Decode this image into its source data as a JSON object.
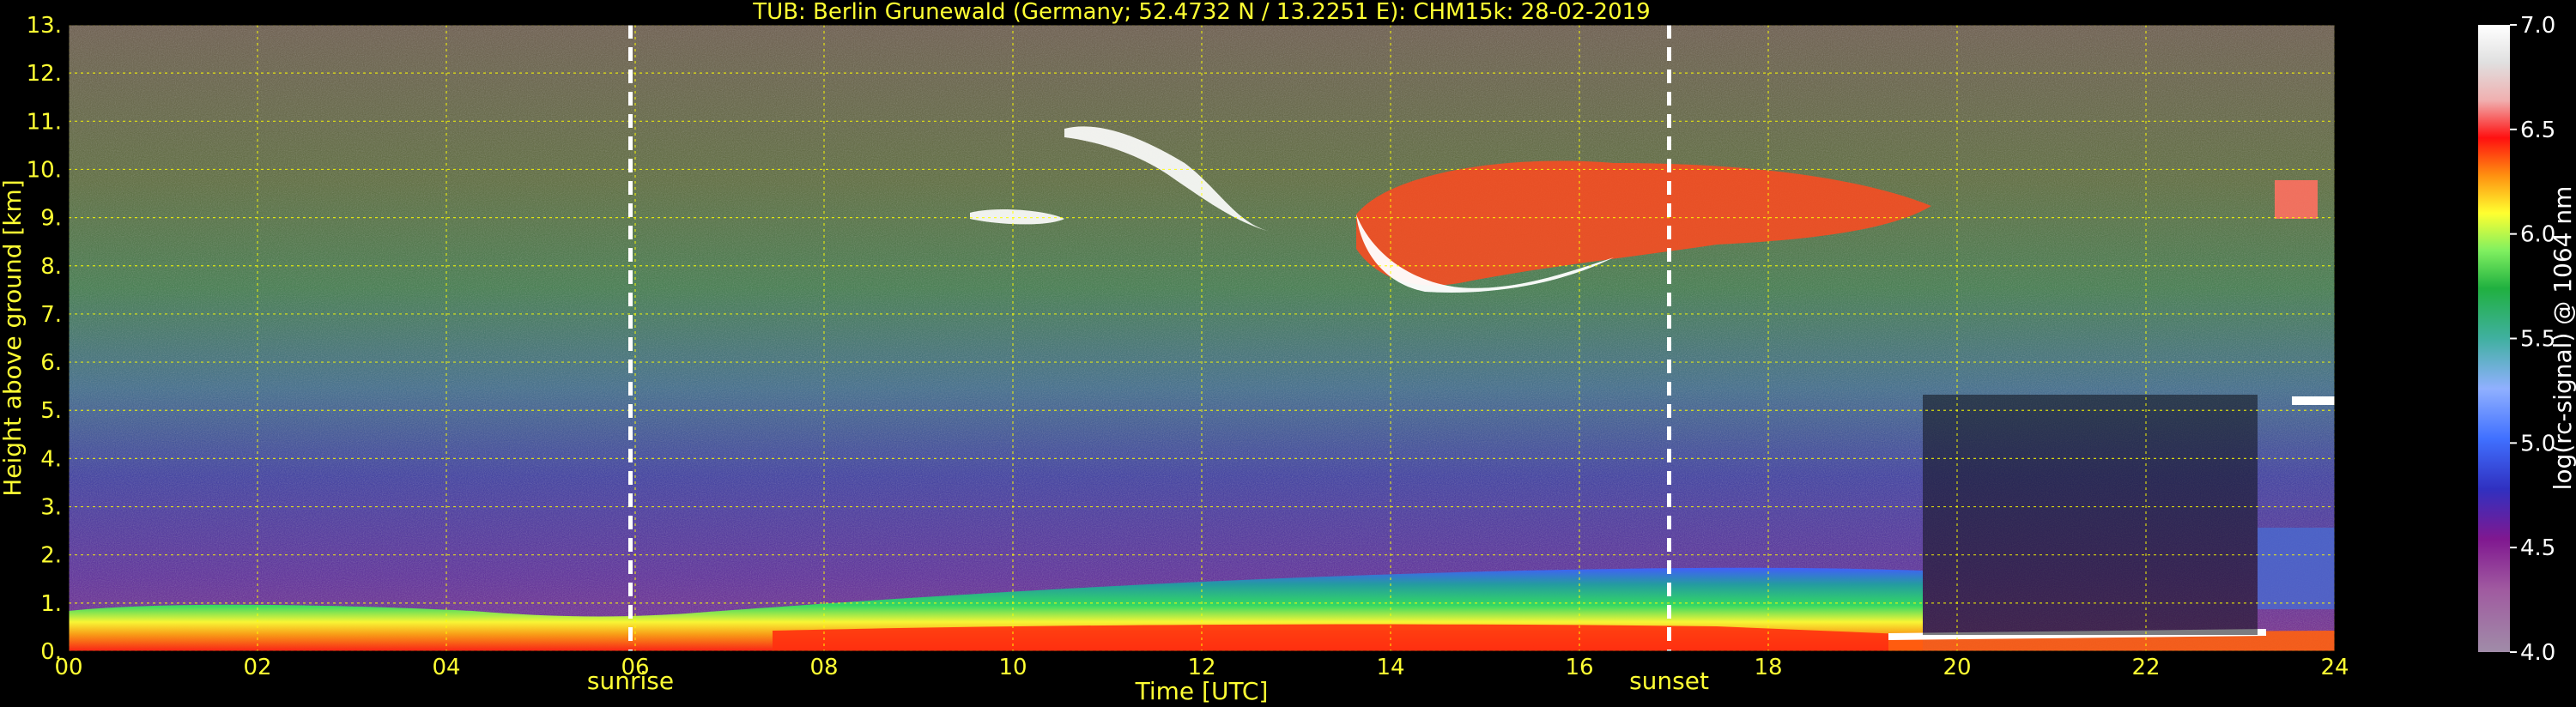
{
  "chart_data": {
    "type": "heatmap",
    "title": "TUB: Berlin Grunewald (Germany; 52.4732 N / 13.2251 E):    CHM15k: 28-02-2019",
    "xlabel": "Time [UTC]",
    "ylabel": "Height above ground [km]",
    "xlim": [
      0,
      24
    ],
    "ylim": [
      0,
      13
    ],
    "x_ticks": [
      "00",
      "02",
      "04",
      "06",
      "08",
      "10",
      "12",
      "14",
      "16",
      "18",
      "20",
      "22",
      "24"
    ],
    "y_ticks": [
      "0.",
      "1.",
      "2.",
      "3.",
      "4.",
      "5.",
      "6.",
      "7.",
      "8.",
      "9.",
      "10.",
      "11.",
      "12.",
      "13."
    ],
    "grid": true,
    "grid_color": "#ffff00",
    "colorbar": {
      "label": "log(rc-signal) @ 1064 nm",
      "range": [
        4.0,
        7.0
      ],
      "ticks": [
        "4.0",
        "4.5",
        "5.0",
        "5.5",
        "6.0",
        "6.5",
        "7.0"
      ]
    },
    "markers": [
      {
        "time_utc": 5.95,
        "label": "sunrise"
      },
      {
        "time_utc": 16.95,
        "label": "sunset"
      }
    ]
  }
}
